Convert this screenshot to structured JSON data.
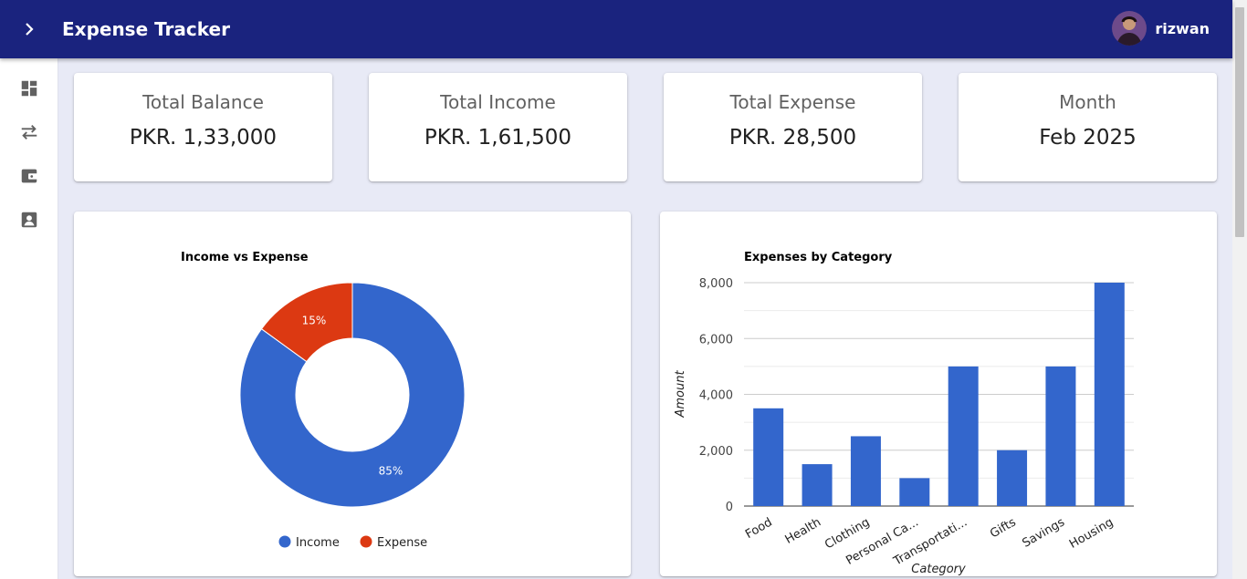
{
  "app": {
    "title": "Expense Tracker"
  },
  "user": {
    "name": "rizwan"
  },
  "sidebar": {
    "items": [
      "dashboard-icon",
      "transactions-icon",
      "wallet-icon",
      "profile-icon"
    ]
  },
  "stats": [
    {
      "label": "Total Balance",
      "value": "PKR. 1,33,000"
    },
    {
      "label": "Total Income",
      "value": "PKR. 1,61,500"
    },
    {
      "label": "Total Expense",
      "value": "PKR. 28,500"
    },
    {
      "label": "Month",
      "value": "Feb 2025"
    }
  ],
  "colors": {
    "appbar": "#1a237e",
    "income": "#3366cc",
    "expense": "#dc3912",
    "background": "#e8eaf6"
  },
  "chart_data": [
    {
      "type": "pie",
      "title": "Income vs Expense",
      "donut": true,
      "slices": [
        {
          "label": "Income",
          "value": 85,
          "display": "85%",
          "color": "#3366cc"
        },
        {
          "label": "Expense",
          "value": 15,
          "display": "15%",
          "color": "#dc3912"
        }
      ],
      "legend": "bottom"
    },
    {
      "type": "bar",
      "title": "Expenses by Category",
      "xlabel": "Category",
      "ylabel": "Amount",
      "categories": [
        "Food",
        "Health",
        "Clothing",
        "Personal Ca...",
        "Transportati...",
        "Gifts",
        "Savings",
        "Housing"
      ],
      "values": [
        3500,
        1500,
        2500,
        1000,
        5000,
        2000,
        5000,
        8000
      ],
      "ylim": [
        0,
        8000
      ],
      "yticks": [
        "0",
        "2,000",
        "4,000",
        "6,000",
        "8,000"
      ],
      "color": "#3366cc",
      "grid": true
    }
  ]
}
